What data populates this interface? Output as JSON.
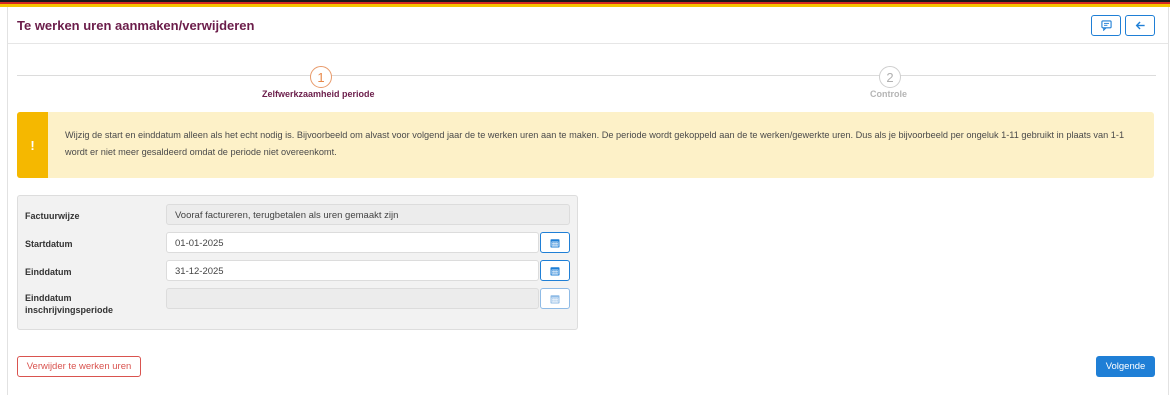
{
  "header": {
    "title": "Te werken uren aanmaken/verwijderen",
    "comment_icon": "comment-icon",
    "back_icon": "arrow-left-icon"
  },
  "stepper": {
    "steps": [
      {
        "number": "1",
        "label": "Zelfwerkzaamheid periode",
        "active": true
      },
      {
        "number": "2",
        "label": "Controle",
        "active": false
      }
    ]
  },
  "alert": {
    "icon": "!",
    "text": "Wijzig de start en einddatum alleen als het echt nodig is. Bijvoorbeeld om alvast voor volgend jaar de te werken uren aan te maken. De periode wordt gekoppeld aan de te werken/gewerkte uren. Dus als je bijvoorbeeld per ongeluk 1-11 gebruikt in plaats van 1-1 wordt er niet meer gesaldeerd omdat de periode niet overeenkomt."
  },
  "form": {
    "factuurwijze": {
      "label": "Factuurwijze",
      "value": "Vooraf factureren, terugbetalen als uren gemaakt zijn"
    },
    "startdatum": {
      "label": "Startdatum",
      "value": "01-01-2025"
    },
    "einddatum": {
      "label": "Einddatum",
      "value": "31-12-2025"
    },
    "einddatum_inschrijving": {
      "label": "Einddatum inschrijvingsperiode",
      "value": ""
    }
  },
  "actions": {
    "delete_label": "Verwijder te werken uren",
    "next_label": "Volgende"
  },
  "colors": {
    "title": "#6b1d4a",
    "primary": "#1f7fd6",
    "danger": "#d9534f",
    "warning": "#f5b800",
    "warning_bg": "#fdf1c8"
  }
}
